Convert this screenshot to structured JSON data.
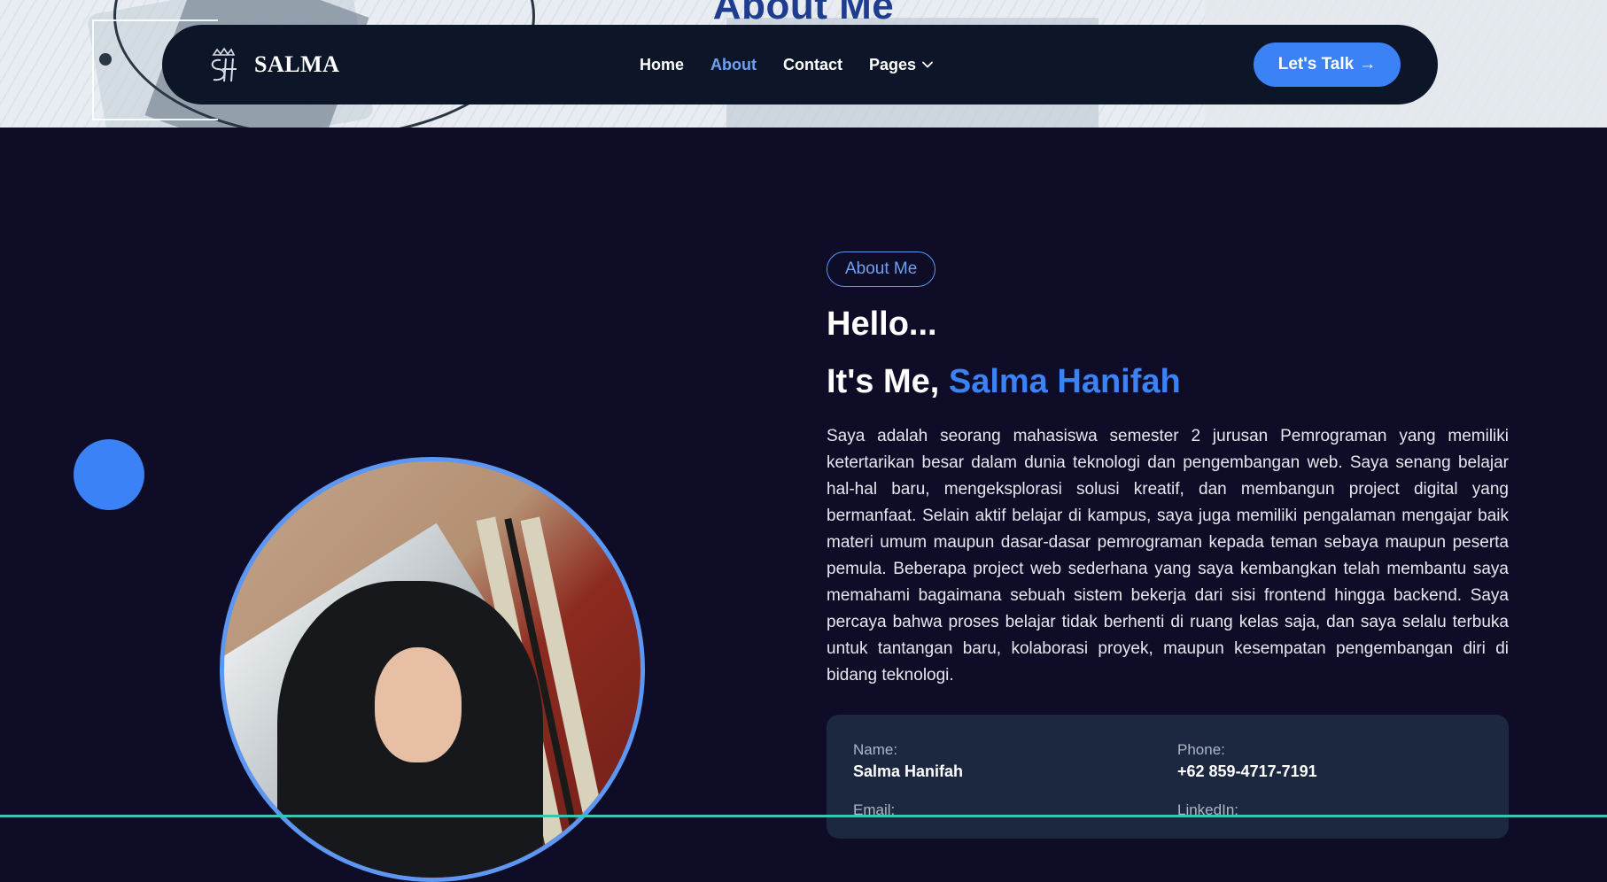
{
  "banner": {
    "title": "About Me"
  },
  "navbar": {
    "brand_name": "SALMA",
    "links": [
      {
        "label": "Home",
        "active": false
      },
      {
        "label": "About",
        "active": true
      },
      {
        "label": "Contact",
        "active": false
      },
      {
        "label": "Pages",
        "active": false
      }
    ],
    "cta_label": "Let's Talk",
    "cta_arrow": "→"
  },
  "about": {
    "badge": "About Me",
    "greeting": "Hello...",
    "intro_prefix": "It's Me,",
    "intro_name": "Salma Hanifah",
    "bio": "Saya adalah seorang mahasiswa semester 2 jurusan Pemrograman yang memiliki ketertarikan besar dalam dunia teknologi dan pengembangan web. Saya senang belajar hal-hal baru, mengeksplorasi solusi kreatif, dan membangun project digital yang bermanfaat. Selain aktif belajar di kampus, saya juga memiliki pengalaman mengajar baik materi umum maupun dasar-dasar pemrograman kepada teman sebaya maupun peserta pemula. Beberapa project web sederhana yang saya kembangkan telah membantu saya memahami bagaimana sebuah sistem bekerja dari sisi frontend hingga backend. Saya percaya bahwa proses belajar tidak berhenti di ruang kelas saja, dan saya selalu terbuka untuk tantangan baru, kolaborasi proyek, maupun kesempatan pengembangan diri di bidang teknologi."
  },
  "info": {
    "name_label": "Name:",
    "name_value": "Salma Hanifah",
    "phone_label": "Phone:",
    "phone_value": "+62 859-4717-7191",
    "email_label": "Email:",
    "linkedin_label": "LinkedIn:"
  },
  "colors": {
    "background": "#0e0c27",
    "accent": "#3b82f6",
    "nav_bg": "#0d1628",
    "card_bg": "#1c2740"
  }
}
